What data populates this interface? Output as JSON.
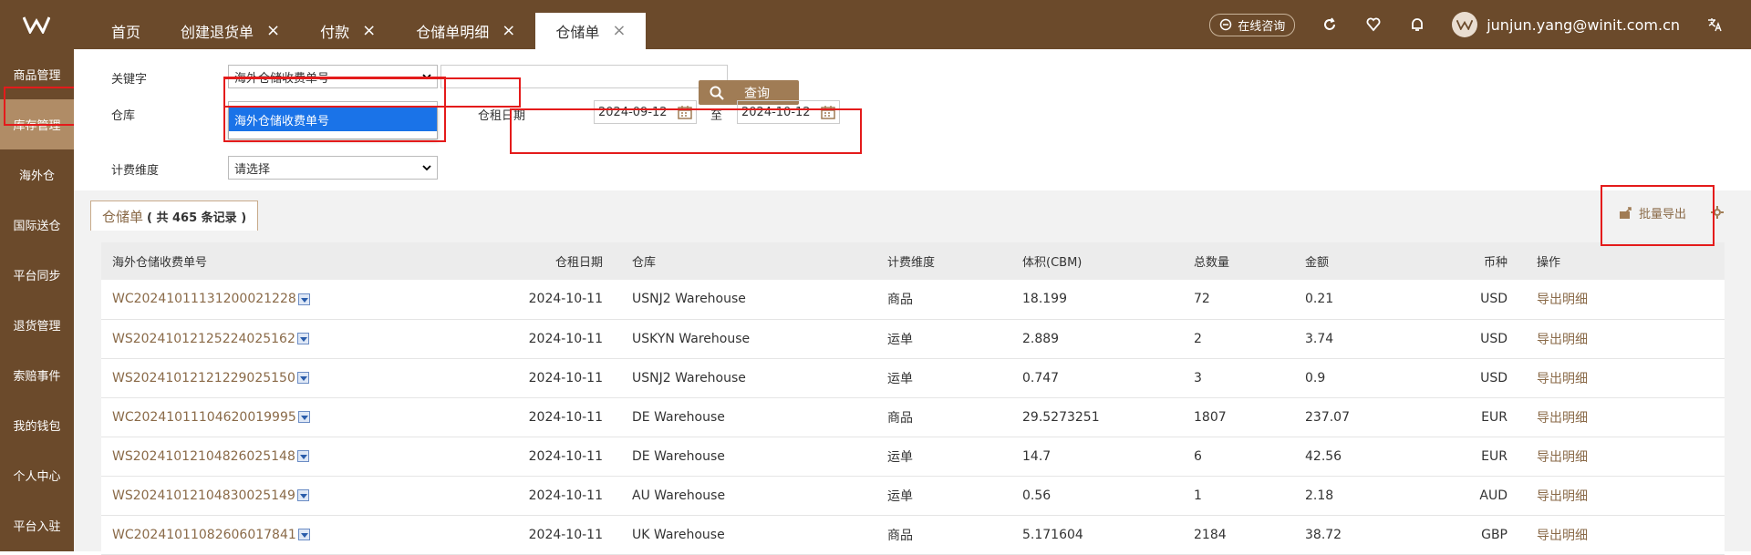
{
  "header": {
    "tabs": [
      {
        "label": "首页",
        "closable": false
      },
      {
        "label": "创建退货单",
        "closable": true
      },
      {
        "label": "付款",
        "closable": true
      },
      {
        "label": "仓储单明细",
        "closable": true
      },
      {
        "label": "仓储单",
        "closable": true,
        "active": true
      }
    ],
    "consult_label": "在线咨询",
    "user_email": "junjun.yang@winit.com.cn",
    "close_glyph": "×"
  },
  "sidebar": {
    "items": [
      "商品管理",
      "库存管理",
      "海外仓",
      "国际送仓",
      "平台同步",
      "退货管理",
      "索赔事件",
      "我的钱包",
      "个人中心",
      "平台入驻"
    ],
    "active_index": 1
  },
  "filters": {
    "keyword_label": "关键字",
    "keyword_selected": "海外仓储收费单号",
    "keyword_dropdown_option": "海外仓储收费单号",
    "warehouse_label": "仓库",
    "date_label": "仓租日期",
    "date_from": "2024-09-12",
    "date_sep": "至",
    "date_to": "2024-10-12",
    "dimension_label": "计费维度",
    "dimension_selected": "请选择",
    "search_label": "查询"
  },
  "list": {
    "tab_title": "仓储单",
    "record_prefix": "( 共 ",
    "record_count": "465",
    "record_suffix": " 条记录 )",
    "export_label": "批量导出"
  },
  "table": {
    "columns": [
      "海外仓储收费单号",
      "仓租日期",
      "仓库",
      "计费维度",
      "体积(CBM)",
      "总数量",
      "金额",
      "币种",
      "操作"
    ],
    "rows": [
      {
        "id": "WC20241011131200021228",
        "date": "2024-10-11",
        "warehouse": "USNJ2 Warehouse",
        "dim": "商品",
        "cbm": "18.199",
        "qty": "72",
        "amount": "0.21",
        "currency": "USD",
        "op": "导出明细"
      },
      {
        "id": "WS20241012125224025162",
        "date": "2024-10-11",
        "warehouse": "USKYN Warehouse",
        "dim": "运单",
        "cbm": "2.889",
        "qty": "2",
        "amount": "3.74",
        "currency": "USD",
        "op": "导出明细"
      },
      {
        "id": "WS20241012121229025150",
        "date": "2024-10-11",
        "warehouse": "USNJ2 Warehouse",
        "dim": "运单",
        "cbm": "0.747",
        "qty": "3",
        "amount": "0.9",
        "currency": "USD",
        "op": "导出明细"
      },
      {
        "id": "WC20241011104620019995",
        "date": "2024-10-11",
        "warehouse": "DE Warehouse",
        "dim": "商品",
        "cbm": "29.5273251",
        "qty": "1807",
        "amount": "237.07",
        "currency": "EUR",
        "op": "导出明细"
      },
      {
        "id": "WS20241012104826025148",
        "date": "2024-10-11",
        "warehouse": "DE Warehouse",
        "dim": "运单",
        "cbm": "14.7",
        "qty": "6",
        "amount": "42.56",
        "currency": "EUR",
        "op": "导出明细"
      },
      {
        "id": "WS20241012104830025149",
        "date": "2024-10-11",
        "warehouse": "AU Warehouse",
        "dim": "运单",
        "cbm": "0.56",
        "qty": "1",
        "amount": "2.18",
        "currency": "AUD",
        "op": "导出明细"
      },
      {
        "id": "WC20241011082606017841",
        "date": "2024-10-11",
        "warehouse": "UK Warehouse",
        "dim": "商品",
        "cbm": "5.171604",
        "qty": "2184",
        "amount": "38.72",
        "currency": "GBP",
        "op": "导出明细"
      }
    ]
  },
  "colors": {
    "brand": "#6b4a2b",
    "accent": "#a07c55",
    "highlight": "#e41b1b",
    "link": "#8a6a48"
  }
}
